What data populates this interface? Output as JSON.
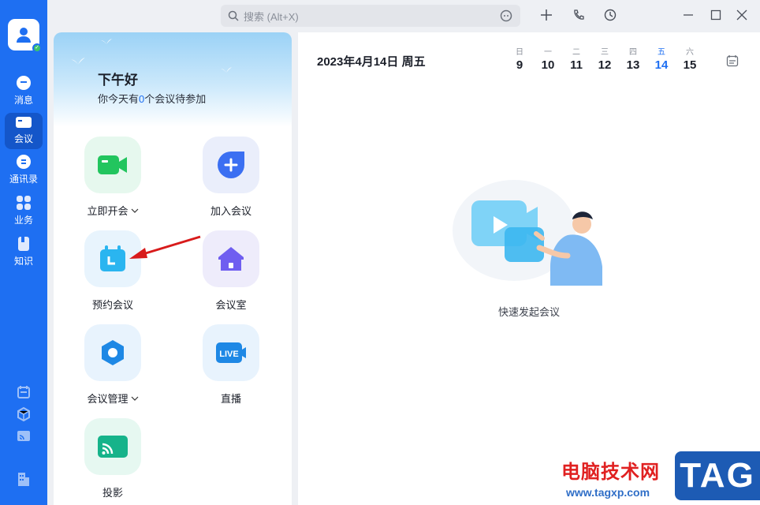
{
  "colors": {
    "brand": "#1e6ff2",
    "today": "#1e6ff2",
    "watermark_red": "#e02020"
  },
  "rail": {
    "items": [
      {
        "label": "消息",
        "icon": "chat-icon"
      },
      {
        "label": "会议",
        "icon": "video-icon",
        "active": true
      },
      {
        "label": "通讯录",
        "icon": "contacts-icon"
      },
      {
        "label": "业务",
        "icon": "apps-grid-icon"
      },
      {
        "label": "知识",
        "icon": "book-icon"
      }
    ],
    "bottom_icons": [
      "calendar-icon",
      "cube-icon",
      "cast-icon",
      "building-icon"
    ]
  },
  "search": {
    "placeholder": "搜索 (Alt+X)"
  },
  "top_icons": [
    "add-icon",
    "phone-icon",
    "history-icon",
    "minimize-icon",
    "maximize-icon",
    "close-icon"
  ],
  "greeting": {
    "title": "下午好",
    "prefix": "你今天有",
    "count": "0",
    "suffix": "个会议待参加"
  },
  "tiles": [
    {
      "label": "立即开会",
      "dropdown": true
    },
    {
      "label": "加入会议"
    },
    {
      "label": "预约会议"
    },
    {
      "label": "会议室"
    },
    {
      "label": "会议管理",
      "dropdown": true
    },
    {
      "label": "直播"
    },
    {
      "label": "投影"
    }
  ],
  "calendar": {
    "date": "2023年4月14日 周五",
    "days": [
      {
        "wd": "日",
        "dn": "9"
      },
      {
        "wd": "一",
        "dn": "10"
      },
      {
        "wd": "二",
        "dn": "11"
      },
      {
        "wd": "三",
        "dn": "12"
      },
      {
        "wd": "四",
        "dn": "13"
      },
      {
        "wd": "五",
        "dn": "14",
        "today": true
      },
      {
        "wd": "六",
        "dn": "15"
      }
    ]
  },
  "empty_state": {
    "text": "快速发起会议"
  },
  "live_badge": "LIVE",
  "watermark": {
    "title": "电脑技术网",
    "url": "www.tagxp.com",
    "tag": "TAG"
  }
}
